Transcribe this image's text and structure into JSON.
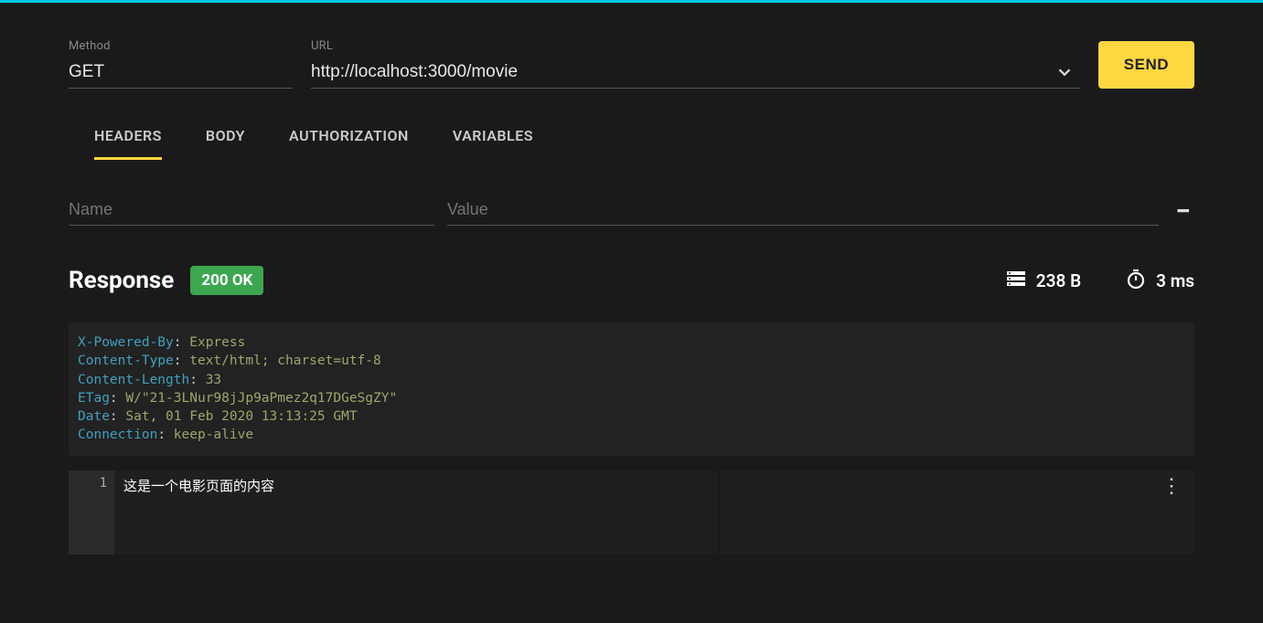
{
  "request": {
    "method_label": "Method",
    "method_value": "GET",
    "url_label": "URL",
    "url_value": "http://localhost:3000/movie",
    "send_label": "SEND"
  },
  "tabs": {
    "headers": "HEADERS",
    "body": "BODY",
    "authorization": "AUTHORIZATION",
    "variables": "VARIABLES"
  },
  "header_form": {
    "name_placeholder": "Name",
    "value_placeholder": "Value"
  },
  "response": {
    "title": "Response",
    "status": "200 OK",
    "size": "238 B",
    "time": "3 ms"
  },
  "response_headers": [
    {
      "name": "X-Powered-By",
      "value": "Express"
    },
    {
      "name": "Content-Type",
      "value": "text/html; charset=utf-8"
    },
    {
      "name": "Content-Length",
      "value": "33"
    },
    {
      "name": "ETag",
      "value": "W/\"21-3LNur98jJp9aPmez2q17DGeSgZY\""
    },
    {
      "name": "Date",
      "value": "Sat, 01 Feb 2020 13:13:25 GMT"
    },
    {
      "name": "Connection",
      "value": "keep-alive"
    }
  ],
  "editor": {
    "line_number": "1",
    "body_text": "这是一个电影页面的内容"
  }
}
